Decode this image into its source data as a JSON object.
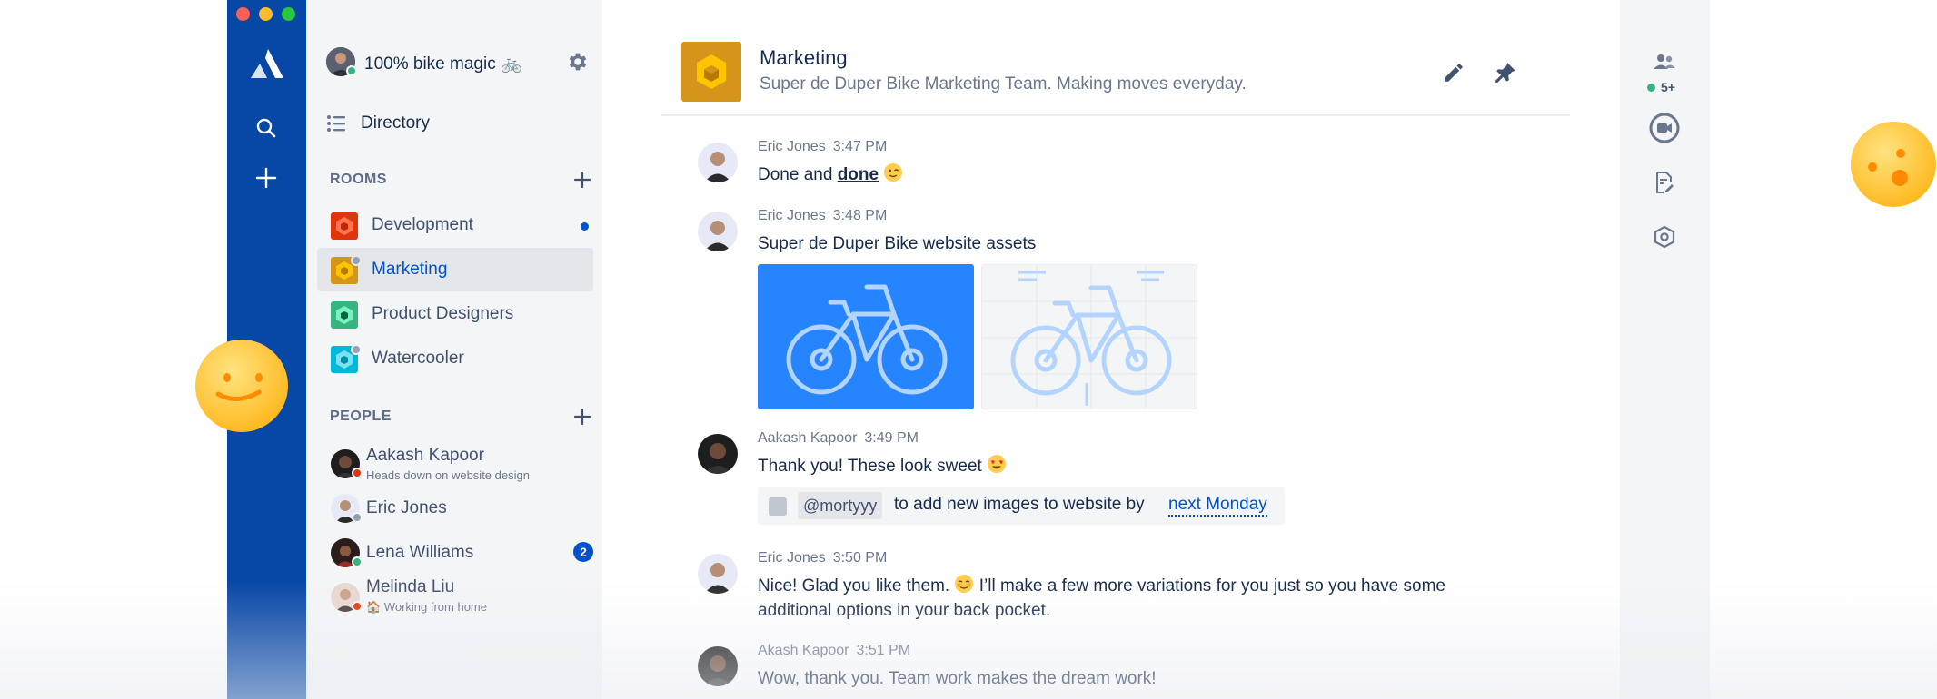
{
  "workspace": {
    "name": "100% bike magic 🚲"
  },
  "sidebar": {
    "directory_label": "Directory",
    "rooms_heading": "ROOMS",
    "people_heading": "PEOPLE",
    "rooms": [
      {
        "name": "Development",
        "color": "#DE350B",
        "unread": true
      },
      {
        "name": "Marketing",
        "color": "#D4951A",
        "active": true
      },
      {
        "name": "Product Designers",
        "color": "#36B37E"
      },
      {
        "name": "Watercooler",
        "color": "#00B8D9"
      }
    ],
    "people": [
      {
        "name": "Aakash Kapoor",
        "status": "Heads down on website design"
      },
      {
        "name": "Eric Jones",
        "status": ""
      },
      {
        "name": "Lena Williams",
        "status": "",
        "badge": "2"
      },
      {
        "name": "Melinda Liu",
        "status": "🏠 Working from home"
      }
    ]
  },
  "room": {
    "title": "Marketing",
    "topic": "Super de Duper Bike Marketing Team. Making moves everyday."
  },
  "messages": [
    {
      "author": "Eric Jones",
      "time": "3:47 PM",
      "text_before": "Done and ",
      "text_bold": "done",
      "emoji": "wink"
    },
    {
      "author": "Eric Jones",
      "time": "3:48 PM",
      "text": "Super de Duper Bike website assets",
      "attachments": [
        "bike-image-blue",
        "bike-image-blueprint"
      ]
    },
    {
      "author": "Aakash Kapoor",
      "time": "3:49 PM",
      "text": "Thank you! These look sweet",
      "emoji": "heart-eyes",
      "task": {
        "mention": "@mortyyy",
        "text": "to add new images to website by",
        "date": "next Monday"
      }
    },
    {
      "author": "Eric Jones",
      "time": "3:50 PM",
      "text_line1_a": "Nice! Glad you like them.",
      "text_line1_b": "I’ll make a few more variations for you just so you have some",
      "text_line2": "additional options in your back pocket.",
      "emoji": "blush"
    },
    {
      "author": "Akash Kapoor",
      "time": "3:51 PM",
      "text": "Wow, thank you. Team work makes the dream work!"
    }
  ],
  "rail": {
    "participants_count": "5+"
  },
  "icons": [
    "atlassian-logo-icon",
    "search-icon",
    "plus-icon",
    "gear-icon",
    "list-icon",
    "pencil-icon",
    "pin-icon",
    "people-icon",
    "video-icon",
    "file-edit-icon",
    "hexagon-settings-icon"
  ],
  "colors": {
    "nav": "#0747A6",
    "accent": "#0052CC",
    "sidebar": "#F4F5F7",
    "presence_online": "#36B37E",
    "presence_busy": "#DE350B"
  }
}
